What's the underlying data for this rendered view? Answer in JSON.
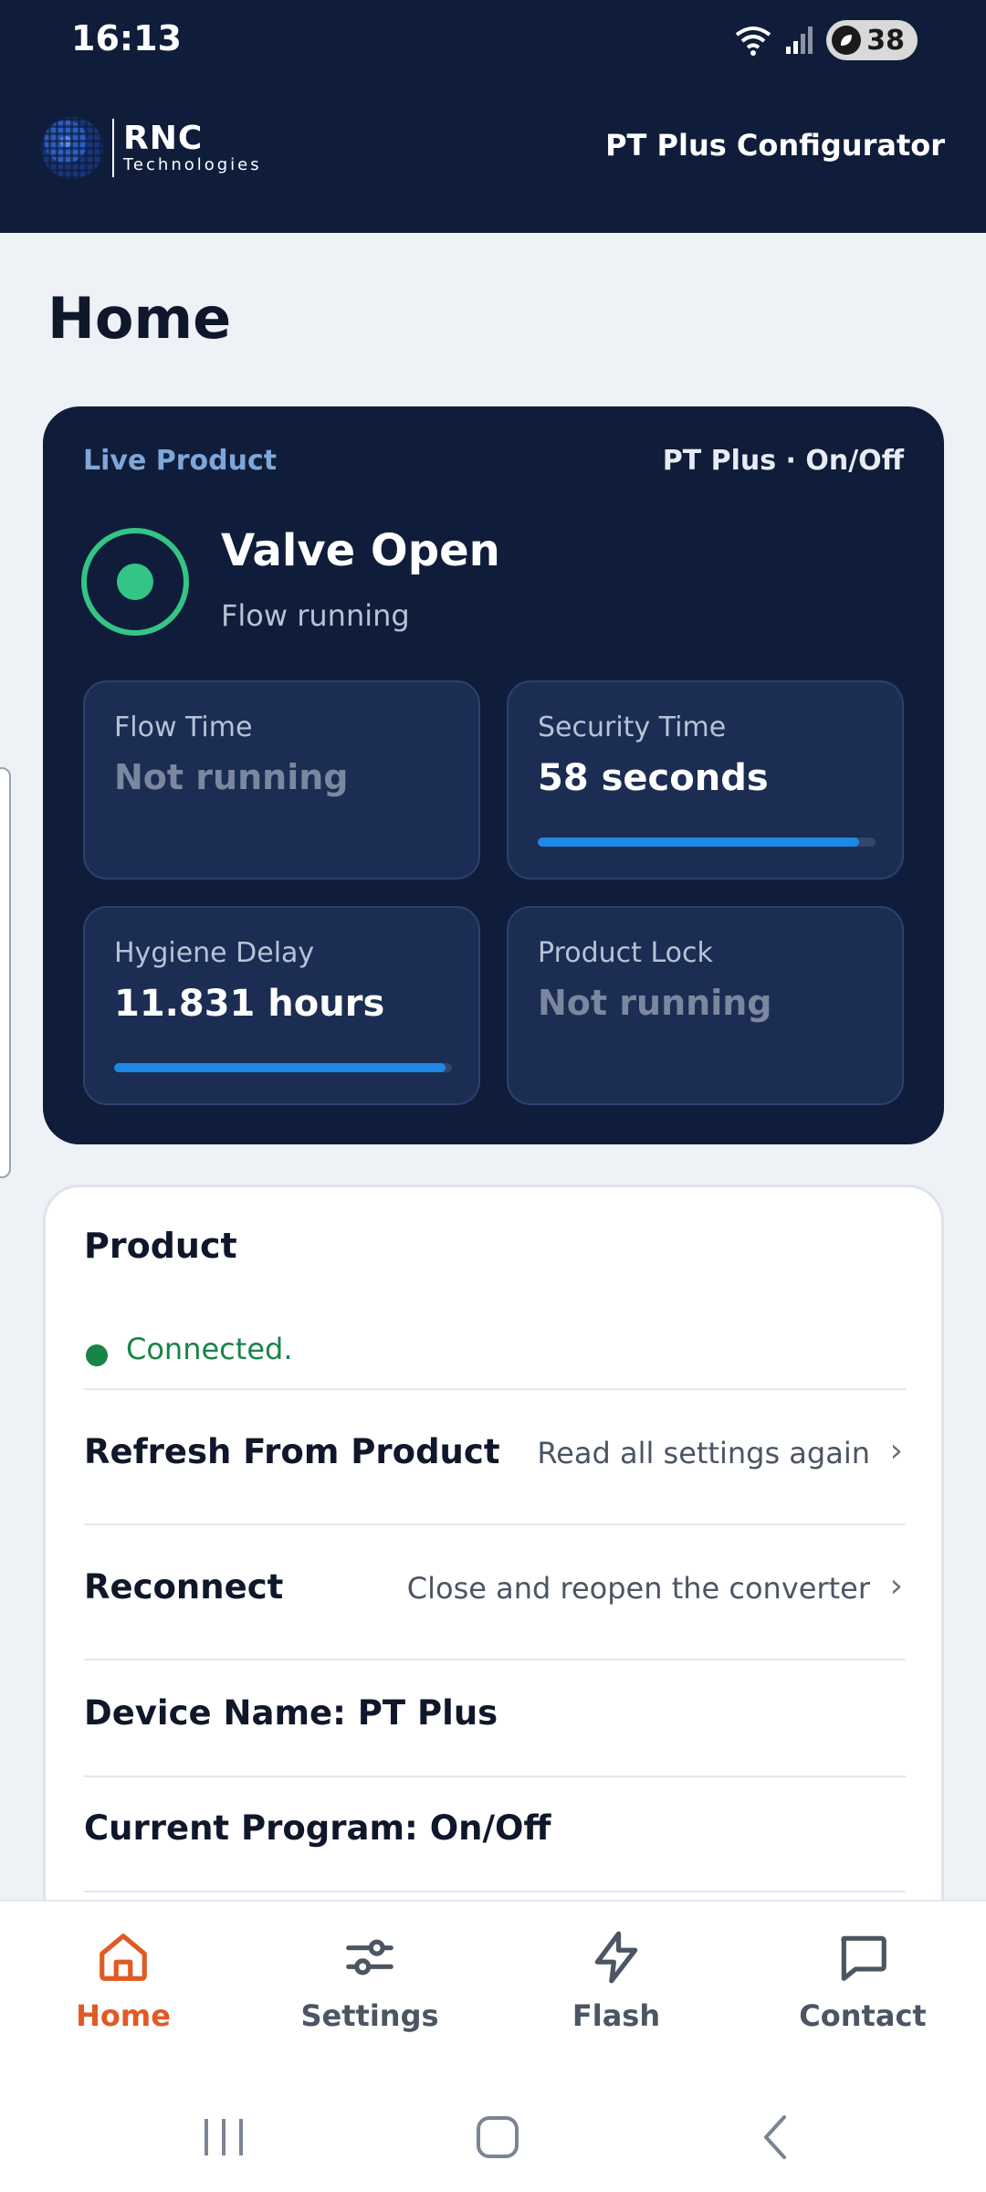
{
  "status_bar": {
    "time": "16:13",
    "battery": "38"
  },
  "header": {
    "logo_name": "RNC",
    "logo_sub": "Technologies",
    "app_title": "PT Plus Configurator"
  },
  "page": {
    "title": "Home"
  },
  "live": {
    "label": "Live Product",
    "model": "PT Plus · On/Off",
    "valve_title": "Valve Open",
    "valve_sub": "Flow running",
    "accent": "#34c486",
    "tiles": [
      {
        "label": "Flow Time",
        "value": "Not running"
      },
      {
        "label": "Security Time",
        "value": "58 seconds",
        "progress": 0.95
      },
      {
        "label": "Hygiene Delay",
        "value": "11.831 hours",
        "progress": 0.98
      },
      {
        "label": "Product Lock",
        "value": "Not running"
      }
    ]
  },
  "product": {
    "title": "Product",
    "status": "Connected.",
    "status_color": "#178547",
    "rows": [
      {
        "label": "Refresh From Product",
        "hint": "Read all settings again"
      },
      {
        "label": "Reconnect",
        "hint": "Close and reopen the converter"
      },
      {
        "label": "Device Name: PT Plus"
      },
      {
        "label": "Current Program: On/Off"
      }
    ]
  },
  "nav": {
    "active_color": "#e05a24",
    "items": [
      {
        "label": "Home",
        "icon": "home-icon"
      },
      {
        "label": "Settings",
        "icon": "sliders-icon"
      },
      {
        "label": "Flash",
        "icon": "lightning-icon"
      },
      {
        "label": "Contact",
        "icon": "message-icon"
      }
    ]
  }
}
